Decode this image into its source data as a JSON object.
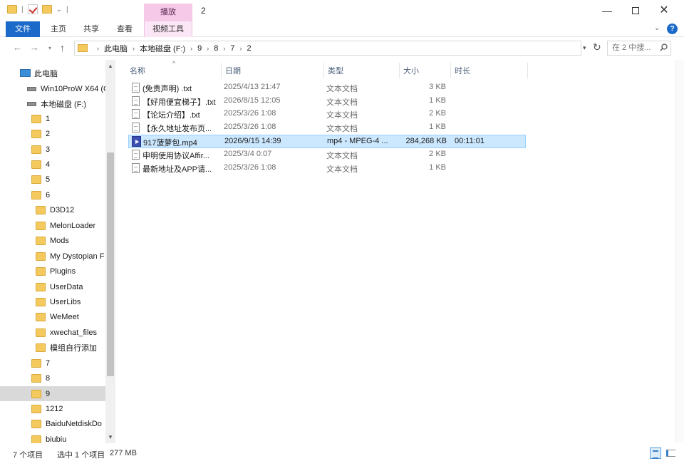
{
  "window": {
    "title": "2",
    "contextual_tab_group": "播放",
    "controls": {
      "minimize": "—",
      "maximize": "",
      "close": "✕"
    }
  },
  "ribbon": {
    "tabs": [
      "文件",
      "主页",
      "共享",
      "查看",
      "视频工具"
    ],
    "help": "?"
  },
  "address": {
    "crumbs": [
      "此电脑",
      "本地磁盘 (F:)",
      "9",
      "8",
      "7",
      "2"
    ],
    "search_placeholder": "在 2 中搜..."
  },
  "sidebar": {
    "items": [
      {
        "label": "此电脑",
        "kind": "pc"
      },
      {
        "label": "Win10ProW X64 (C",
        "kind": "drive"
      },
      {
        "label": "本地磁盘 (F:)",
        "kind": "drive"
      },
      {
        "label": "1",
        "kind": "folder"
      },
      {
        "label": "2",
        "kind": "folder"
      },
      {
        "label": "3",
        "kind": "folder"
      },
      {
        "label": "4",
        "kind": "folder"
      },
      {
        "label": "5",
        "kind": "folder"
      },
      {
        "label": "6",
        "kind": "folder"
      },
      {
        "label": "D3D12",
        "kind": "folder"
      },
      {
        "label": "MelonLoader",
        "kind": "folder"
      },
      {
        "label": "Mods",
        "kind": "folder"
      },
      {
        "label": "My Dystopian F",
        "kind": "folder"
      },
      {
        "label": "Plugins",
        "kind": "folder"
      },
      {
        "label": "UserData",
        "kind": "folder"
      },
      {
        "label": "UserLibs",
        "kind": "folder"
      },
      {
        "label": "WeMeet",
        "kind": "folder"
      },
      {
        "label": "xwechat_files",
        "kind": "folder"
      },
      {
        "label": "模组自行添加",
        "kind": "folder"
      },
      {
        "label": "7",
        "kind": "folder"
      },
      {
        "label": "8",
        "kind": "folder"
      },
      {
        "label": "9",
        "kind": "folder",
        "selected": true
      },
      {
        "label": "1212",
        "kind": "folder"
      },
      {
        "label": "BaiduNetdiskDo",
        "kind": "folder"
      },
      {
        "label": "biubiu",
        "kind": "folder"
      }
    ]
  },
  "columns": {
    "name": "名称",
    "date": "日期",
    "type": "类型",
    "size": "大小",
    "duration": "时长"
  },
  "files": [
    {
      "name": "(免责声明) .txt",
      "date": "2025/4/13 21:47",
      "type": "文本文档",
      "size": "3 KB",
      "duration": "",
      "icon": "text-file-icon"
    },
    {
      "name": "【好用便宜梯子】.txt",
      "date": "2026/8/15 12:05",
      "type": "文本文档",
      "size": "1 KB",
      "duration": "",
      "icon": "text-file-icon"
    },
    {
      "name": "【论坛介绍】.txt",
      "date": "2025/3/26 1:08",
      "type": "文本文档",
      "size": "2 KB",
      "duration": "",
      "icon": "text-file-icon"
    },
    {
      "name": "【永久地址发布页...",
      "date": "2025/3/26 1:08",
      "type": "文本文档",
      "size": "1 KB",
      "duration": "",
      "icon": "text-file-icon"
    },
    {
      "name": "917菠萝包.mp4",
      "date": "2026/9/15 14:39",
      "type": "mp4 - MPEG-4 ...",
      "size": "284,268 KB",
      "duration": "00:11:01",
      "icon": "video-file-icon",
      "selected": true
    },
    {
      "name": "申明使用协议Affir...",
      "date": "2025/3/4 0:07",
      "type": "文本文档",
      "size": "2 KB",
      "duration": "",
      "icon": "text-file-icon"
    },
    {
      "name": "最新地址及APP请...",
      "date": "2025/3/26 1:08",
      "type": "文本文档",
      "size": "1 KB",
      "duration": "",
      "icon": "text-file-icon"
    }
  ],
  "status": {
    "item_count": "7 个项目",
    "selection": "选中 1 个项目",
    "selection_size": "277 MB"
  }
}
